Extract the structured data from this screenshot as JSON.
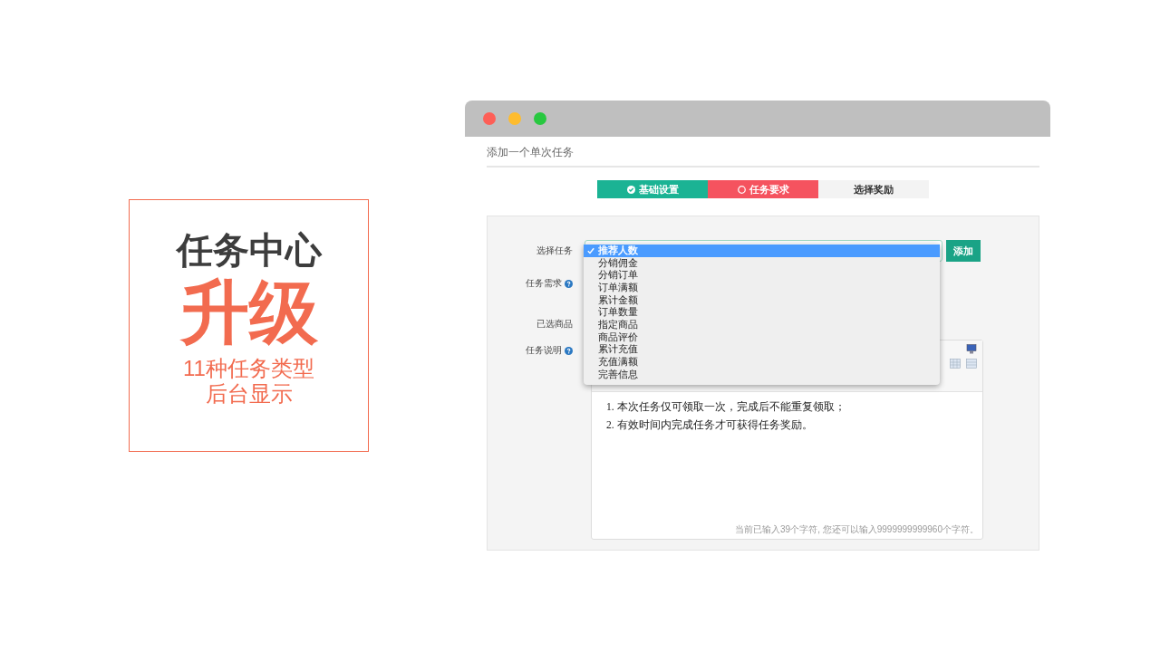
{
  "slide": {
    "heading": "任务中心",
    "highlight": "升级",
    "subtitle_lines": [
      "11种任务类型",
      "后台显示"
    ]
  },
  "window": {
    "page_title": "添加一个单次任务"
  },
  "steps": [
    {
      "label": "基础设置",
      "kind": "done"
    },
    {
      "label": "任务要求",
      "kind": "current"
    },
    {
      "label": "选择奖励",
      "kind": "pending"
    }
  ],
  "form": {
    "fields": [
      {
        "label": "选择任务",
        "help": false
      },
      {
        "label": "任务需求",
        "help": true
      },
      {
        "label": "已选商品",
        "help": false
      },
      {
        "label": "任务说明",
        "help": true
      }
    ],
    "add_button": "添加",
    "task_options": [
      {
        "label": "推荐人数",
        "selected": true
      },
      {
        "label": "分销佣金",
        "selected": false
      },
      {
        "label": "分销订单",
        "selected": false
      },
      {
        "label": "订单满额",
        "selected": false
      },
      {
        "label": "累计金额",
        "selected": false
      },
      {
        "label": "订单数量",
        "selected": false
      },
      {
        "label": "指定商品",
        "selected": false
      },
      {
        "label": "商品评价",
        "selected": false
      },
      {
        "label": "累计充值",
        "selected": false
      },
      {
        "label": "充值满额",
        "selected": false
      },
      {
        "label": "完善信息",
        "selected": false
      }
    ]
  },
  "editor": {
    "lines": [
      "1. 本次任务仅可领取一次，完成后不能重复领取；",
      "2. 有效时间内完成任务才可获得任务奖励。"
    ],
    "counter": "当前已输入39个字符, 您还可以输入9999999999960个字符。"
  }
}
